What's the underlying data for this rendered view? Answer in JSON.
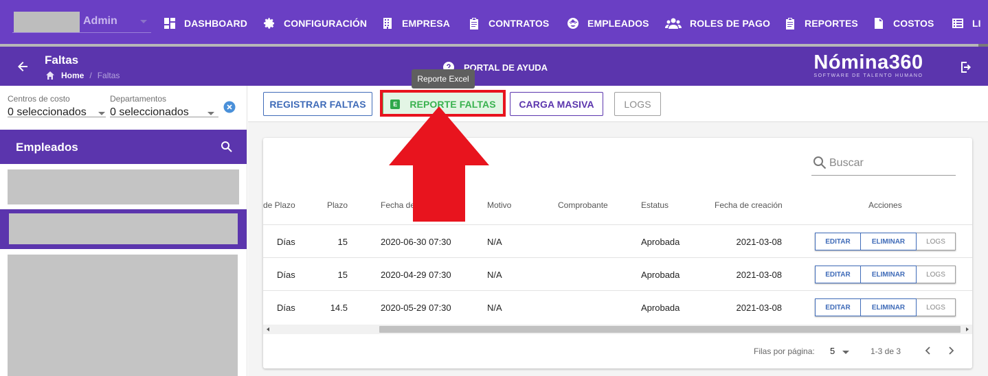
{
  "topnav": {
    "user_label": "Admin",
    "items": [
      {
        "label": "DASHBOARD",
        "icon": "dashboard-icon"
      },
      {
        "label": "CONFIGURACIÓN",
        "icon": "gear-icon"
      },
      {
        "label": "EMPRESA",
        "icon": "building-icon"
      },
      {
        "label": "CONTRATOS",
        "icon": "clipboard-icon"
      },
      {
        "label": "EMPLEADOS",
        "icon": "face-icon"
      },
      {
        "label": "ROLES DE PAGO",
        "icon": "people-icon"
      },
      {
        "label": "REPORTES",
        "icon": "report-icon"
      },
      {
        "label": "COSTOS",
        "icon": "costs-icon"
      },
      {
        "label": "LI",
        "icon": "list-icon"
      }
    ],
    "progress": 0.99
  },
  "subheader": {
    "title": "Faltas",
    "breadcrumb_home": "Home",
    "breadcrumb_sep": "/",
    "breadcrumb_current": "Faltas",
    "help_label": "PORTAL DE AYUDA",
    "brand_name": "Nómina360",
    "brand_tagline": "SOFTWARE DE TALENTO HUMANO"
  },
  "tooltip": "Reporte Excel",
  "sidebar": {
    "cost_centers_label": "Centros de costo",
    "cost_centers_value": "0 seleccionados",
    "departments_label": "Departamentos",
    "departments_value": "0 seleccionados",
    "employees_title": "Empleados"
  },
  "toolbar": {
    "register": "REGISTRAR FALTAS",
    "report": "REPORTE FALTAS",
    "report_badge": "E",
    "bulk": "CARGA MASIVA",
    "logs": "LOGS"
  },
  "table": {
    "search_placeholder": "Buscar",
    "columns": [
      "de Plazo",
      "Plazo",
      "Fecha de",
      "Motivo",
      "Comprobante",
      "Estatus",
      "Fecha de creación",
      "Acciones"
    ],
    "rows": [
      {
        "tipo": "Días",
        "plazo": "15",
        "fecha": "2020-06-30 07:30",
        "motivo": "N/A",
        "comprobante": "",
        "estatus": "Aprobada",
        "creacion": "2021-03-08"
      },
      {
        "tipo": "Días",
        "plazo": "15",
        "fecha": "2020-04-29 07:30",
        "motivo": "N/A",
        "comprobante": "",
        "estatus": "Aprobada",
        "creacion": "2021-03-08"
      },
      {
        "tipo": "Días",
        "plazo": "14.5",
        "fecha": "2020-05-29 07:30",
        "motivo": "N/A",
        "comprobante": "",
        "estatus": "Aprobada",
        "creacion": "2021-03-08"
      }
    ],
    "actions": {
      "edit": "EDITAR",
      "delete": "ELIMINAR",
      "logs": "LOGS"
    },
    "rows_per_page_label": "Filas por página:",
    "rows_per_page": "5",
    "range": "1-3 de 3"
  },
  "colors": {
    "nav_purple": "#6a3fc4",
    "header_purple": "#5b35ad",
    "accent_blue": "#3f6bb8",
    "excel_green": "#39b24f",
    "annotation_red": "#e8141e"
  }
}
